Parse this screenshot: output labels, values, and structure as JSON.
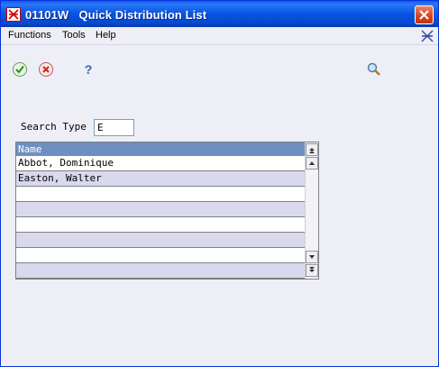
{
  "window": {
    "title": "01101W   Quick Distribution List"
  },
  "menu": {
    "functions_label": "Functions",
    "tools_label": "Tools",
    "help_label": "Help"
  },
  "toolbar": {
    "ok_icon": "check-icon",
    "cancel_icon": "cancel-icon",
    "help_icon": "help-question-icon",
    "find_icon": "search-magnifier-icon",
    "help_glyph": "?"
  },
  "form": {
    "search_type_label": "Search Type",
    "search_type_value": "E"
  },
  "grid": {
    "header_name": "Name",
    "rows": [
      "Abbot, Dominique",
      "Easton, Walter",
      "",
      "",
      "",
      "",
      "",
      ""
    ]
  },
  "colors": {
    "title_bar": "#0754e2",
    "grid_header": "#6e8fbf",
    "row_alt": "#d8d8ee",
    "background": "#eeeef6"
  }
}
